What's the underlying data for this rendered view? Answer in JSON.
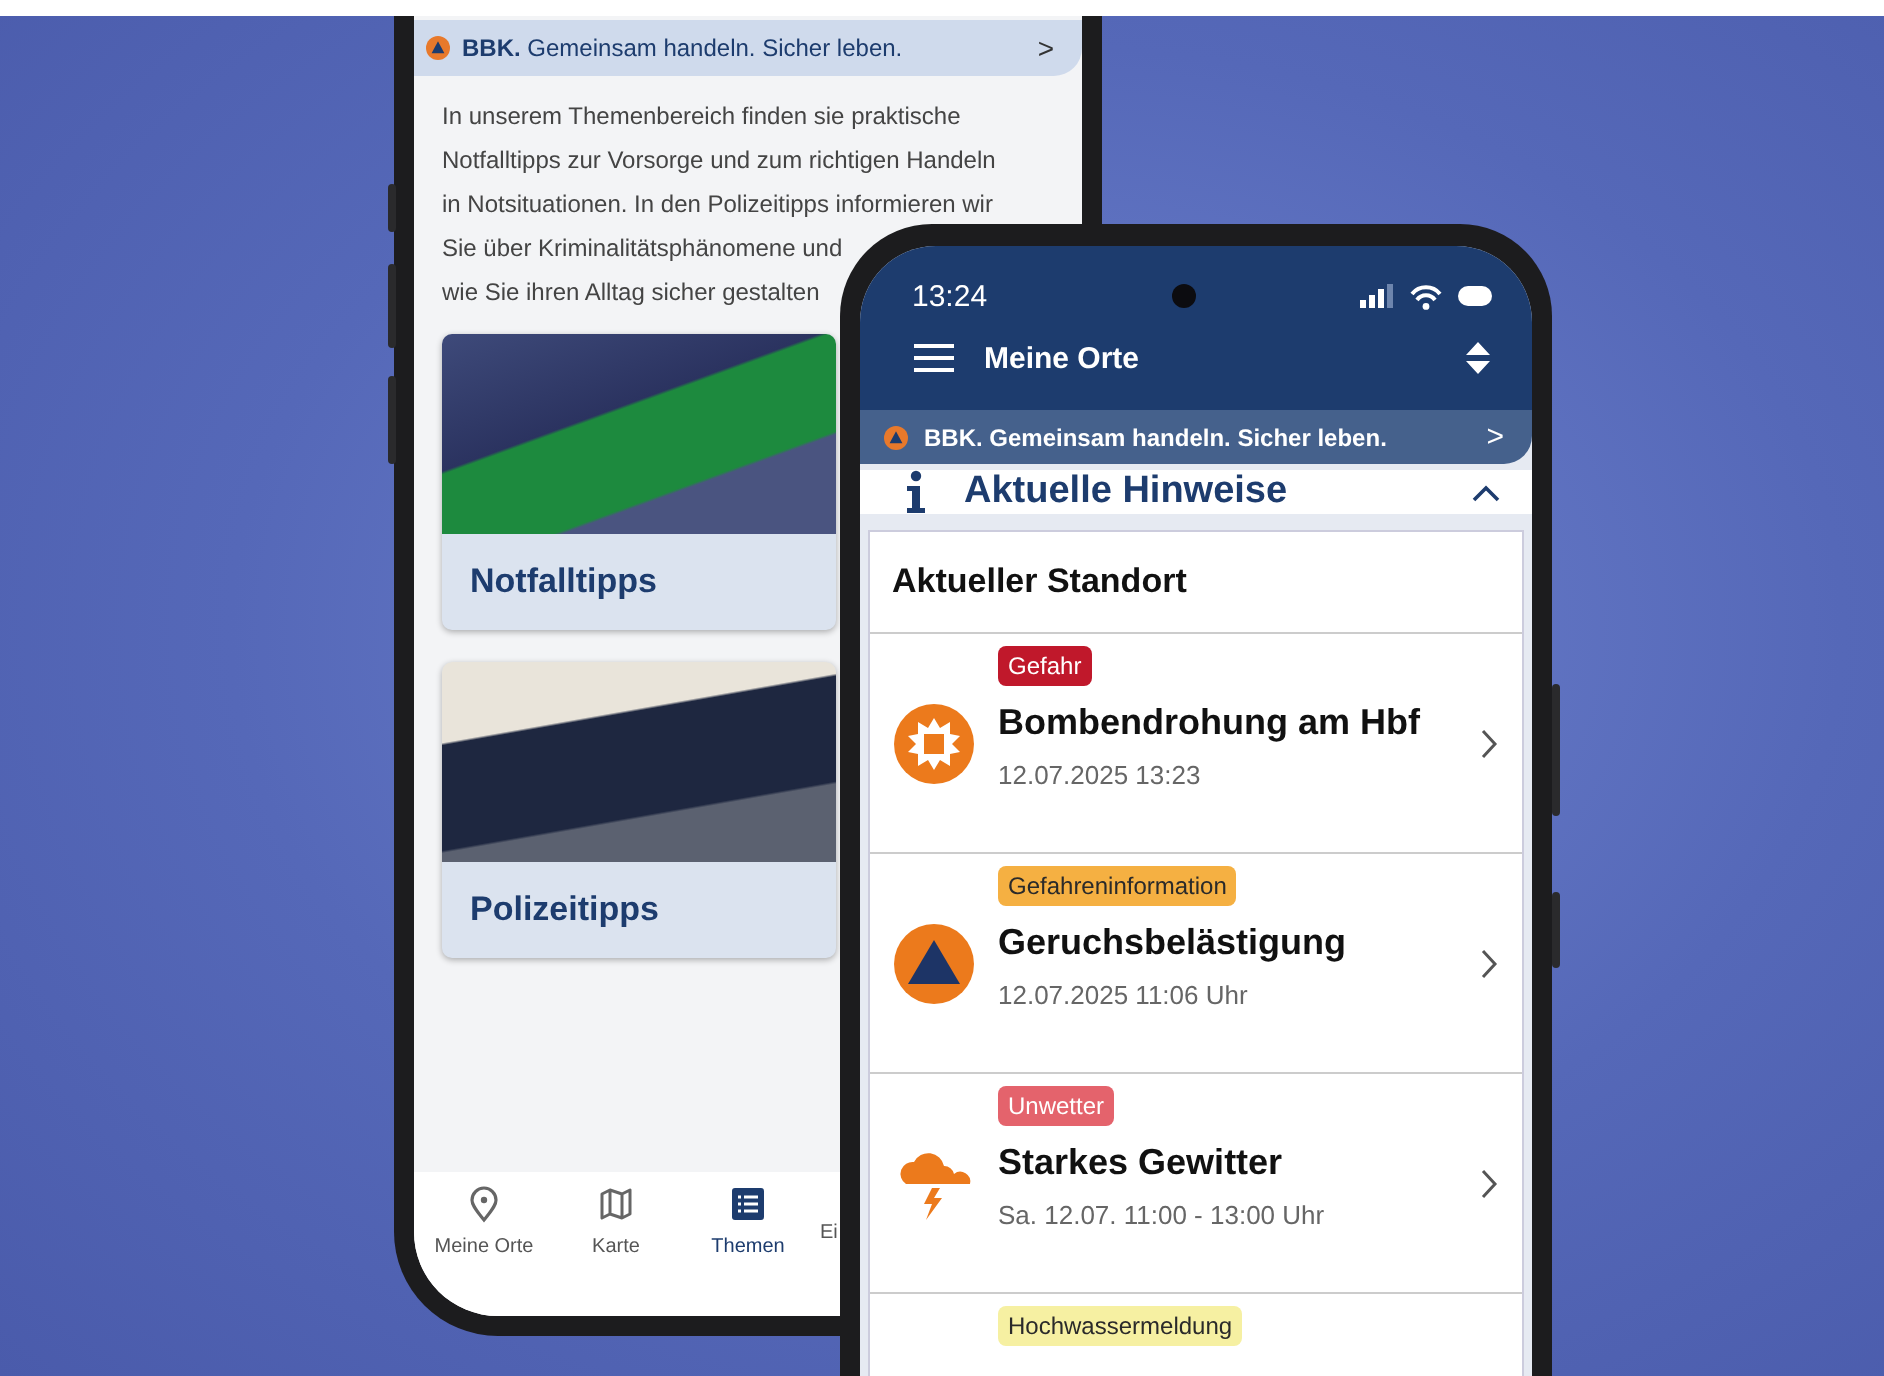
{
  "back_phone": {
    "banner": {
      "text": "**BBK.** Gemeinsam handeln. Sicher leben.",
      "chevron": ">"
    },
    "intro_lines": [
      "In unserem Themenbereich finden sie praktische",
      "Notfalltipps zur Vorsorge und zum richtigen Handeln",
      "in Notsituationen. In den Polizeitipps informieren wir",
      "Sie über Kriminalitätsphänomene und",
      "wie Sie ihren Alltag sicher gestalten"
    ],
    "topics": [
      {
        "label": "Notfalltipps"
      },
      {
        "label": "Polizeitipps"
      }
    ],
    "nav": [
      {
        "label": "Meine Orte",
        "kind": "pin",
        "selected": false
      },
      {
        "label": "Karte",
        "kind": "map",
        "selected": false
      },
      {
        "label": "Themen",
        "kind": "list",
        "selected": true
      },
      {
        "label": "Ei",
        "selected": false
      }
    ]
  },
  "front_phone": {
    "status_bar": {
      "time": "13:24"
    },
    "toolbar": {
      "title": "Meine Orte"
    },
    "banner": {
      "text": "BBK. Gemeinsam handeln. Sicher leben.",
      "chevron": ">"
    },
    "section": {
      "title": "Aktuelle Hinweise",
      "expanded": true
    },
    "location": {
      "title": "Aktueller Standort"
    },
    "warnings": [
      {
        "badge": "Gefahr",
        "color": "#c0182b",
        "kind": "explosion",
        "title": "Bombendrohung am Hbf",
        "date": "12.07.2025 13:23"
      },
      {
        "badge": "Gefahreninformation",
        "color": "#f5b042",
        "kind": "triangle",
        "title": "Geruchsbelästigung",
        "date": "12.07.2025 11:06 Uhr"
      },
      {
        "badge": "Unwetter",
        "color": "#e4636c",
        "kind": "storm",
        "title": "Starkes Gewitter",
        "date": "Sa. 12.07. 11:00 - 13:00 Uhr"
      },
      {
        "badge": "Hochwassermeldung",
        "color": "#f6f0a2"
      }
    ]
  }
}
